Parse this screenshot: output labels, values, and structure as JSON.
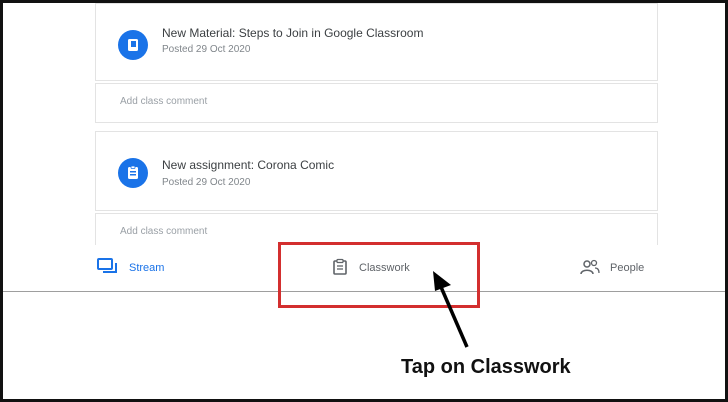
{
  "posts": [
    {
      "title": "New Material: Steps to Join in Google Classroom",
      "date": "Posted 29 Oct 2020",
      "icon": "material-doc-icon"
    },
    {
      "title": "New assignment: Corona Comic",
      "date": "Posted 29 Oct 2020",
      "icon": "assignment-clipboard-icon"
    }
  ],
  "comment_placeholder": "Add class comment",
  "nav": {
    "stream": "Stream",
    "classwork": "Classwork",
    "people": "People"
  },
  "annotation": {
    "caption": "Tap on Classwork"
  },
  "colors": {
    "accent": "#1a73e8",
    "highlight": "#d32f2f"
  }
}
